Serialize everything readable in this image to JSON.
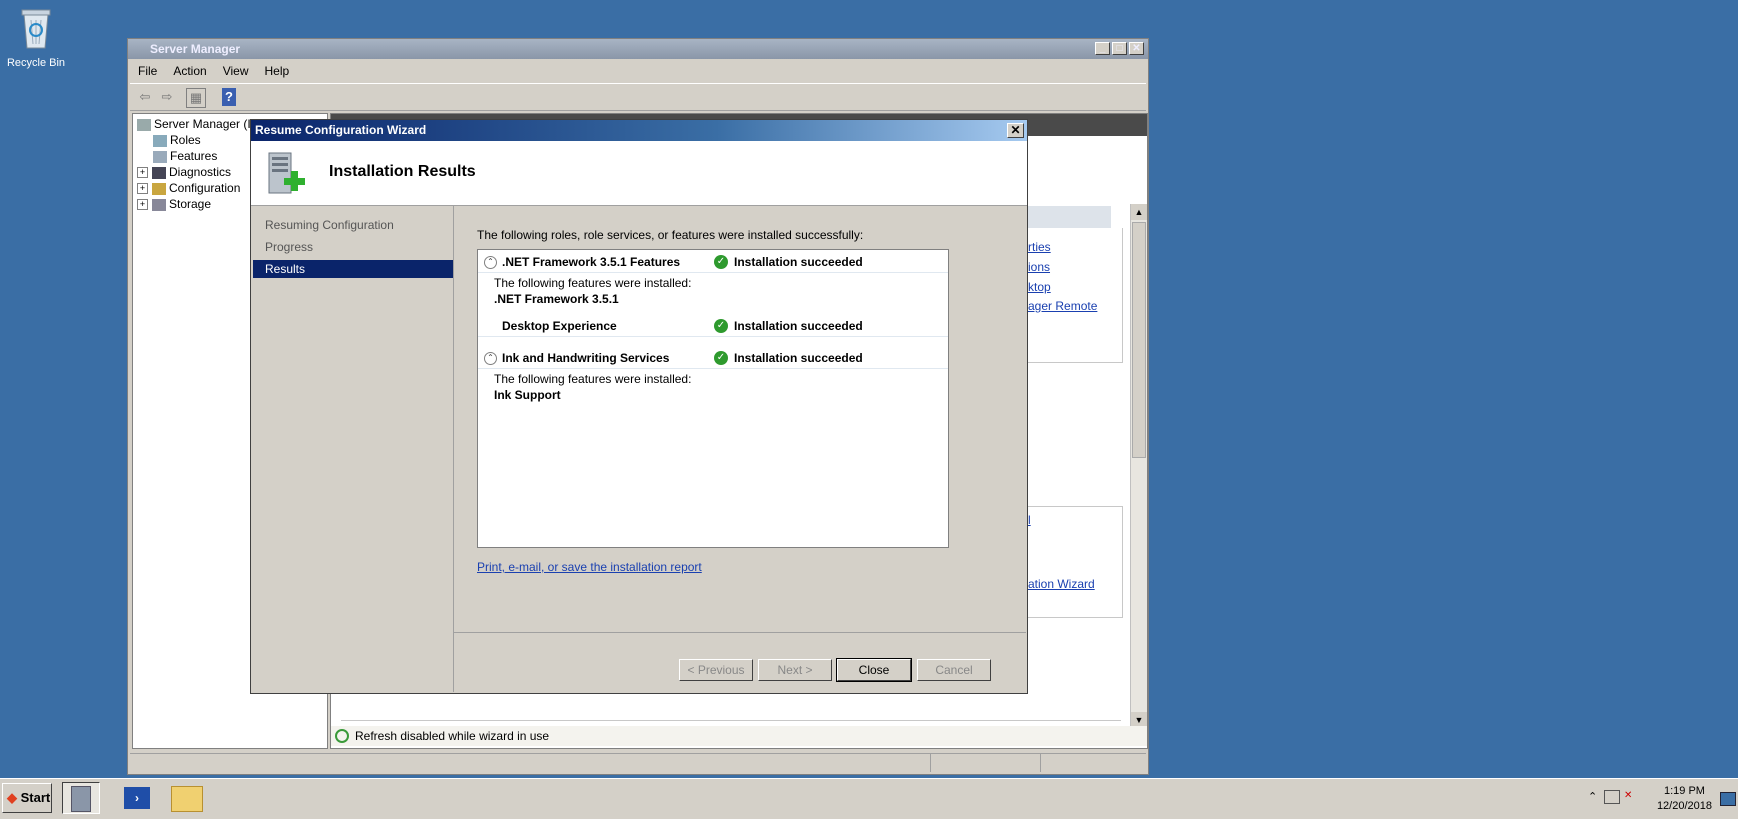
{
  "desktop": {
    "recycle_bin_label": "Recycle Bin"
  },
  "server_manager": {
    "title": "Server Manager",
    "menu": [
      "File",
      "Action",
      "View",
      "Help"
    ],
    "tree": [
      {
        "label": "Server Manager (IE…",
        "expander": ""
      },
      {
        "label": "Roles",
        "expander": ""
      },
      {
        "label": "Features",
        "expander": ""
      },
      {
        "label": "Diagnostics",
        "expander": "+"
      },
      {
        "label": "Configuration",
        "expander": "+"
      },
      {
        "label": "Storage",
        "expander": "+"
      }
    ],
    "right_links": [
      "rties",
      "ions",
      "ktop",
      "ager Remote",
      "l",
      "ation Wizard"
    ],
    "status_text": "Refresh disabled while wizard in use"
  },
  "wizard": {
    "title": "Resume Configuration Wizard",
    "close_glyph": "✕",
    "heading": "Installation Results",
    "nav": [
      "Resuming Configuration",
      "Progress",
      "Results"
    ],
    "active_nav_index": 2,
    "intro": "The following roles, role services, or features were installed successfully:",
    "results": [
      {
        "name": ".NET Framework 3.5.1 Features",
        "status": "Installation succeeded",
        "sub_label": "The following features were installed:",
        "sub_items": [
          ".NET Framework 3.5.1"
        ]
      },
      {
        "name": "Desktop Experience",
        "status": "Installation succeeded",
        "sub_label": "",
        "sub_items": []
      },
      {
        "name": "Ink and Handwriting Services",
        "status": "Installation succeeded",
        "sub_label": "The following features were installed:",
        "sub_items": [
          "Ink Support"
        ]
      }
    ],
    "report_link": "Print, e-mail, or save the installation report",
    "buttons": {
      "previous": "< Previous",
      "next": "Next >",
      "close": "Close",
      "cancel": "Cancel"
    }
  },
  "taskbar": {
    "start_label": "Start",
    "time": "1:19 PM",
    "date": "12/20/2018"
  },
  "colors": {
    "desktop": "#3a6ea5",
    "title_active": "#0a246a",
    "success": "#2e9a2e",
    "link": "#1a40b0"
  }
}
